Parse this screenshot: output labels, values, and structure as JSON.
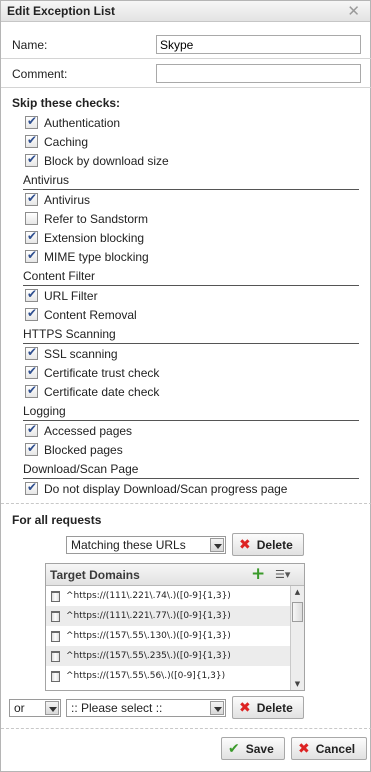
{
  "dialog": {
    "title": "Edit Exception List",
    "close_glyph": "✕"
  },
  "form": {
    "name_label": "Name:",
    "name_value": "Skype",
    "comment_label": "Comment:",
    "comment_value": ""
  },
  "skip": {
    "heading": "Skip these checks:"
  },
  "checks": [
    {
      "label": "Authentication",
      "checked": true
    },
    {
      "label": "Caching",
      "checked": true
    },
    {
      "label": "Block by download size",
      "checked": true
    }
  ],
  "groups": {
    "antivirus": {
      "title": "Antivirus",
      "items": [
        {
          "label": "Antivirus",
          "checked": true
        },
        {
          "label": "Refer to Sandstorm",
          "checked": false
        },
        {
          "label": "Extension blocking",
          "checked": true
        },
        {
          "label": "MIME type blocking",
          "checked": true
        }
      ]
    },
    "content_filter": {
      "title": "Content Filter",
      "items": [
        {
          "label": "URL Filter",
          "checked": true
        },
        {
          "label": "Content Removal",
          "checked": true
        }
      ]
    },
    "https": {
      "title": "HTTPS Scanning",
      "items": [
        {
          "label": "SSL scanning",
          "checked": true
        },
        {
          "label": "Certificate trust check",
          "checked": true
        },
        {
          "label": "Certificate date check",
          "checked": true
        }
      ]
    },
    "logging": {
      "title": "Logging",
      "items": [
        {
          "label": "Accessed pages",
          "checked": true
        },
        {
          "label": "Blocked pages",
          "checked": true
        }
      ]
    },
    "download": {
      "title": "Download/Scan Page",
      "items": [
        {
          "label": "Do not display Download/Scan progress page",
          "checked": true
        }
      ]
    }
  },
  "requests": {
    "heading": "For all requests",
    "match_select": "Matching these URLs",
    "delete_label": "Delete",
    "panel_title": "Target Domains",
    "domains": [
      "^https://(111\\.221\\.74\\.)([0-9]{1,3})",
      "^https://(111\\.221\\.77\\.)([0-9]{1,3})",
      "^https://(157\\.55\\.130\\.)([0-9]{1,3})",
      "^https://(157\\.55\\.235\\.)([0-9]{1,3})",
      "^https://(157\\.55\\.56\\.)([0-9]{1,3})"
    ],
    "or_select": "or",
    "please_select": ":: Please select ::",
    "delete2_label": "Delete"
  },
  "footer": {
    "save_label": "Save",
    "cancel_label": "Cancel"
  },
  "icons": {
    "add": "plus-icon",
    "menu": "list-menu-icon",
    "trash": "trash-icon"
  },
  "colors": {
    "accent_green": "#3a9a2a",
    "delete_red": "#d22222",
    "check_blue": "#2f4f8f"
  }
}
